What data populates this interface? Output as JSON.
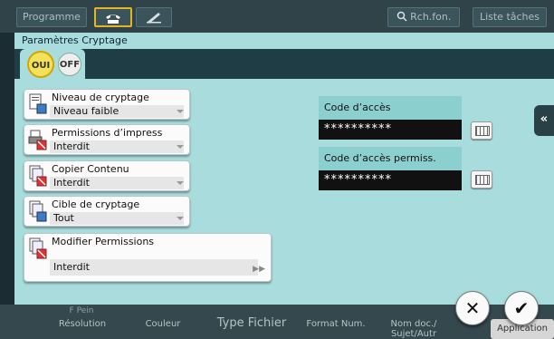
{
  "topbar": {
    "programme_label": "Programme",
    "search_label": "Rch.fon.",
    "jobs_label": "Liste tâches"
  },
  "dialog": {
    "title": "Paramètres Cryptage",
    "toggle_on": "OUI",
    "toggle_off": "OFF",
    "settings": {
      "niveau": {
        "label": "Niveau de cryptage",
        "value": "Niveau faible"
      },
      "permissions": {
        "label": "Permissions d’impress",
        "value": "Interdit"
      },
      "copier": {
        "label": "Copier Contenu",
        "value": "Interdit"
      },
      "cible": {
        "label": "Cible de cryptage",
        "value": "Tout"
      },
      "modifier": {
        "label": "Modifier Permissions",
        "value": "Interdit"
      }
    },
    "code_acces": {
      "label": "Code d’accès",
      "value": "**********"
    },
    "code_perm": {
      "label": "Code d’accès permiss.",
      "value": "**********"
    },
    "side_tab": "«"
  },
  "bottombar": {
    "tabs": [
      "Résolution",
      "Couleur",
      "Type Fichier",
      "Format Num.",
      "Nom doc./ Sujet/Autr",
      "Application"
    ],
    "partial_label": "F Pein"
  },
  "actions": {
    "cancel": "✕",
    "ok": "✔"
  },
  "colors": {
    "dialog_bg": "#a9dddd",
    "accent_yellow": "#f2e15a",
    "dark_bar": "#1f3d45"
  }
}
